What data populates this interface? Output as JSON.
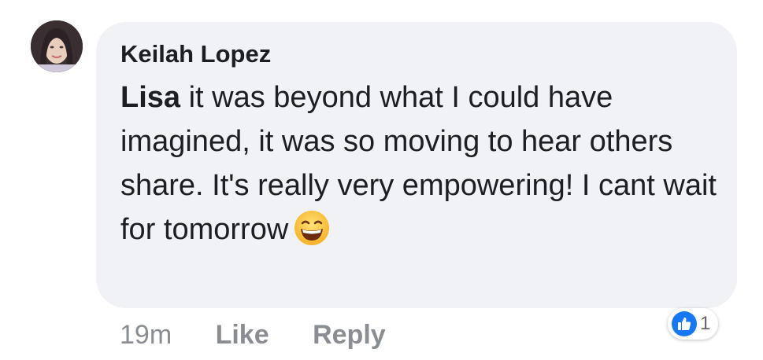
{
  "comment": {
    "author": "Keilah Lopez",
    "mention": "Lisa",
    "text": " it was beyond what I could have imagined, it was so moving to hear others share. It's really very empowering! I cant wait for tomorrow",
    "emoji": "grinning-squinting-face",
    "time": "19m",
    "like_label": "Like",
    "reply_label": "Reply",
    "reaction_count": "1"
  },
  "colors": {
    "bubble": "#f0f2f5",
    "like_blue": "#1877f2",
    "meta_text": "#8a8d91"
  }
}
